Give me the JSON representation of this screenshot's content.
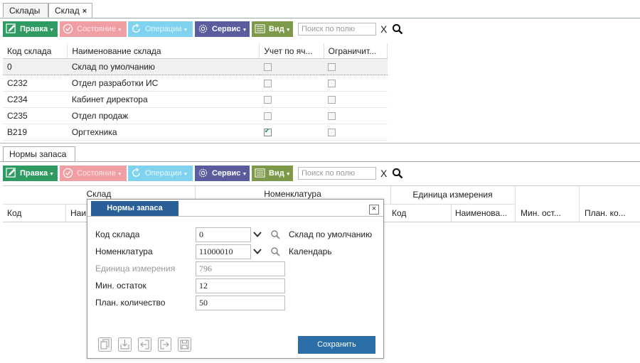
{
  "tabs": {
    "warehouses": "Склады",
    "warehouse": "Склад",
    "close": "×"
  },
  "toolbar1": {
    "edit": "Правка",
    "status": "Состояние",
    "operations": "Операции",
    "service": "Сервис",
    "view": "Вид",
    "search_placeholder": "Поиск по полю",
    "clear": "X"
  },
  "grid": {
    "columns": [
      "Код склада",
      "Наименование склада",
      "Учет по яч...",
      "Ограничит..."
    ],
    "rows": [
      {
        "code": "0",
        "name": "Склад по умолчанию",
        "cell": false,
        "limit": false
      },
      {
        "code": "C232",
        "name": "Отдел разработки ИС",
        "cell": false,
        "limit": false
      },
      {
        "code": "C234",
        "name": "Кабинет директора",
        "cell": false,
        "limit": false
      },
      {
        "code": "C235",
        "name": "Отдел продаж",
        "cell": false,
        "limit": false
      },
      {
        "code": "B219",
        "name": "Оргтехника",
        "cell": true,
        "limit": false
      }
    ]
  },
  "subtab": {
    "label": "Нормы запаса"
  },
  "toolbar2": {
    "edit": "Правка",
    "status": "Состояние",
    "operations": "Операции",
    "service": "Сервис",
    "view": "Вид",
    "search_placeholder": "Поиск по полю",
    "clear": "X"
  },
  "grid2": {
    "group_headers": {
      "warehouse": "Склад",
      "nomenclature": "Номенклатура",
      "unit": "Единица измерения"
    },
    "columns": {
      "code": "Код",
      "name_partial": "Наи",
      "unit_code": "Код",
      "unit_name": "Наименова...",
      "min": "Мин. ост...",
      "plan": "План. ко..."
    }
  },
  "dialog": {
    "title": "Нормы запаса",
    "close": "×",
    "fields": {
      "warehouse_code": {
        "label": "Код склада",
        "value": "0",
        "desc": "Склад по умолчанию"
      },
      "nomenclature": {
        "label": "Номенклатура",
        "value": "11000010",
        "desc": "Календарь"
      },
      "unit": {
        "label": "Единица измерения",
        "value": "796"
      },
      "min_stock": {
        "label": "Мин. остаток",
        "value": "12"
      },
      "plan_qty": {
        "label": "План. количество",
        "value": "50"
      }
    },
    "save": "Сохранить"
  }
}
